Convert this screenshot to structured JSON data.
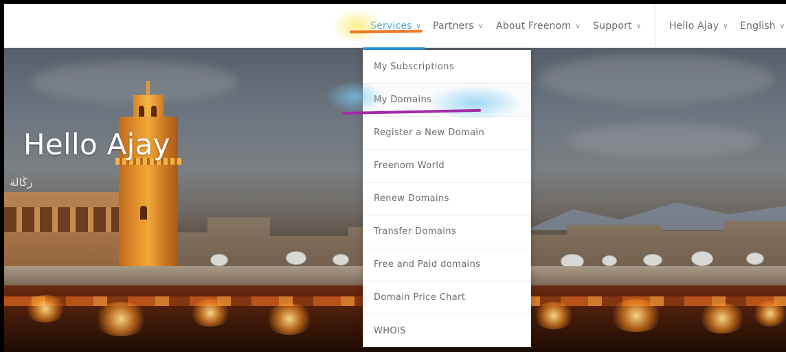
{
  "nav": {
    "items": [
      {
        "label": "Services",
        "active": true
      },
      {
        "label": "Partners",
        "active": false
      },
      {
        "label": "About Freenom",
        "active": false
      },
      {
        "label": "Support",
        "active": false
      }
    ],
    "user_menu": "Hello Ajay",
    "language": "English",
    "chevron_icon": "chevron-down-icon",
    "colors": {
      "active_text": "#4aa6d8",
      "active_bar": "#2d9ad6",
      "text": "#6b6b6b"
    }
  },
  "hero": {
    "title": "Hello Ajay",
    "sign_text": "رڭالة"
  },
  "dropdown": {
    "items": [
      "My Subscriptions",
      "My Domains",
      "Register a New Domain",
      "Freenom World",
      "Renew Domains",
      "Transfer Domains",
      "Free and Paid domains",
      "Domain Price Chart",
      "WHOIS"
    ]
  },
  "annotations": {
    "services_underline_color": "#f07b2a",
    "my_domains_underline_color": "#a02aa8"
  }
}
